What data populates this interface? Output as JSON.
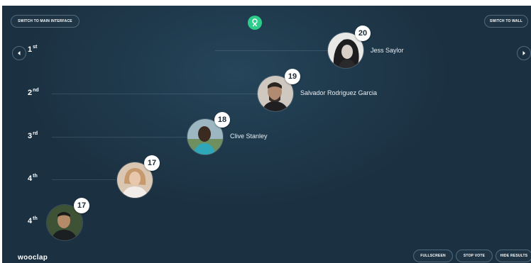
{
  "header": {
    "switch_main_label": "SWITCH TO MAIN INTERFACE",
    "switch_wall_label": "SWITCH TO WALL",
    "center_icon": "trophy-icon"
  },
  "navigation": {
    "prev_icon": "chevron-left-icon",
    "next_icon": "chevron-right-icon"
  },
  "leaderboard": {
    "rows": [
      {
        "rank": "1",
        "suffix": "st",
        "score": "20",
        "name": "Jess Saylor"
      },
      {
        "rank": "2",
        "suffix": "nd",
        "score": "19",
        "name": "Salvador Rodriguez Garcia"
      },
      {
        "rank": "3",
        "suffix": "rd",
        "score": "18",
        "name": "Clive Stanley"
      },
      {
        "rank": "4",
        "suffix": "th",
        "score": "17",
        "name": ""
      },
      {
        "rank": "4",
        "suffix": "th",
        "score": "17",
        "name": ""
      }
    ]
  },
  "footer": {
    "logo_text": "wooclap",
    "fullscreen_label": "FULLSCREEN",
    "stop_vote_label": "STOP VOTE",
    "hide_results_label": "HIDE RESULTS"
  },
  "colors": {
    "background": "#1b3142",
    "accent": "#2ecc8a",
    "badge": "#ffffff"
  }
}
